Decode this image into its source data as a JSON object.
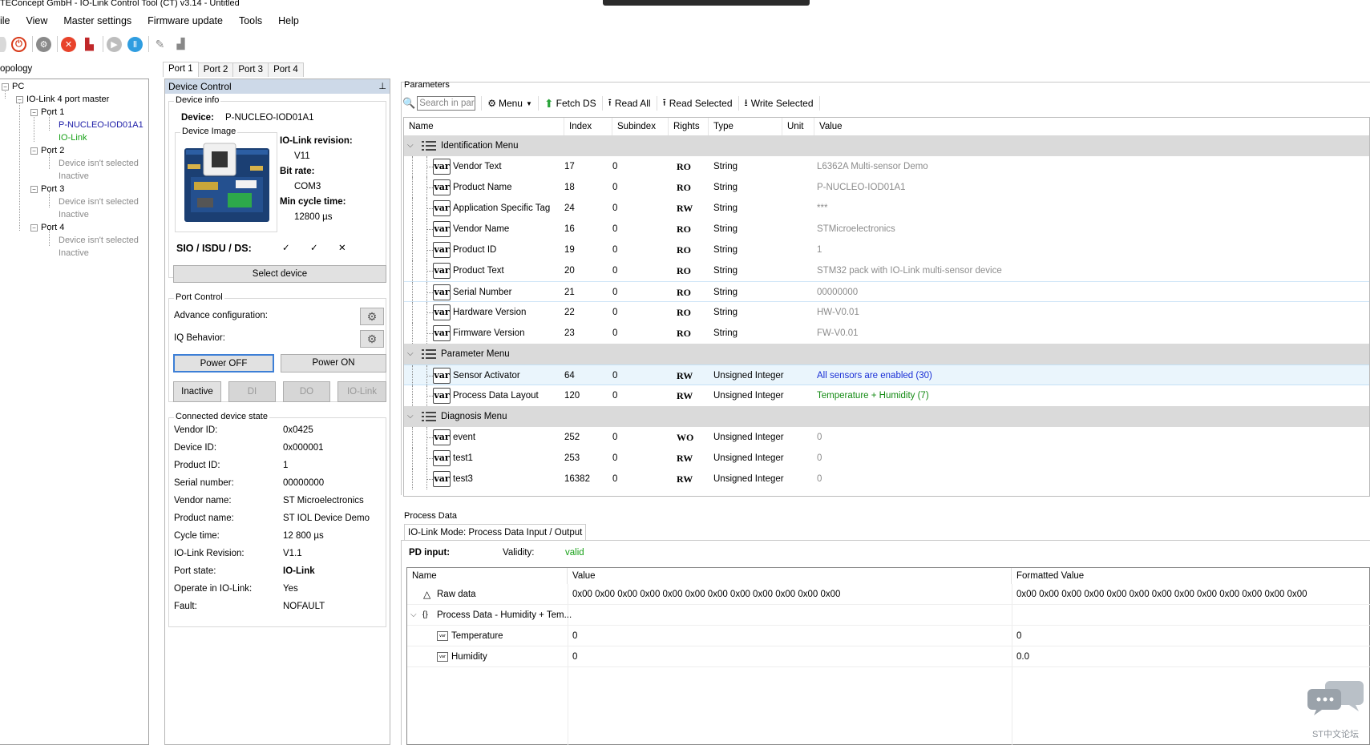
{
  "window": {
    "title": "TEConcept GmbH - IO-Link Control Tool (CT) v3.14 - Untitled"
  },
  "menu": [
    "ile",
    "View",
    "Master settings",
    "Firmware update",
    "Tools",
    "Help"
  ],
  "toolbar_icons": [
    "stop-icon",
    "power-icon",
    "gear-icon",
    "close-icon",
    "disconnect-icon",
    "play-icon",
    "pause-icon",
    "wrench-icon",
    "plug-icon"
  ],
  "topology": {
    "label": "opology",
    "root": "PC",
    "master": "IO-Link 4 port master",
    "ports": [
      {
        "name": "Port 1",
        "device": "P-NUCLEO-IOD01A1",
        "state": "IO-Link"
      },
      {
        "name": "Port 2",
        "device": "Device isn't selected",
        "state": "Inactive"
      },
      {
        "name": "Port 3",
        "device": "Device isn't selected",
        "state": "Inactive"
      },
      {
        "name": "Port 4",
        "device": "Device isn't selected",
        "state": "Inactive"
      }
    ]
  },
  "port_tabs": [
    "Port 1",
    "Port 2",
    "Port 3",
    "Port 4"
  ],
  "device_control": {
    "header": "Device Control",
    "pin": "⊥",
    "device_info_label": "Device info",
    "device_label": "Device:",
    "device_value": "P-NUCLEO-IOD01A1",
    "device_image_label": "Device Image",
    "iolink_revision_label": "IO-Link revision:",
    "iolink_revision_value": "V11",
    "bit_rate_label": "Bit rate:",
    "bit_rate_value": "COM3",
    "min_cycle_label": "Min cycle time:",
    "min_cycle_value": "12800 µs",
    "sio_label": "SIO / ISDU / DS:",
    "sio_values": [
      "✓",
      "✓",
      "✕"
    ],
    "select_device": "Select device",
    "port_control_label": "Port Control",
    "advance_config": "Advance configuration:",
    "iq_behavior": "IQ Behavior:",
    "power_off": "Power OFF",
    "power_on": "Power ON",
    "modes": [
      "Inactive",
      "DI",
      "DO",
      "IO-Link"
    ],
    "connected_state_label": "Connected device state",
    "state_rows": [
      {
        "label": "Vendor ID:",
        "value": "0x0425"
      },
      {
        "label": "Device ID:",
        "value": "0x000001"
      },
      {
        "label": "Product ID:",
        "value": "1"
      },
      {
        "label": "Serial number:",
        "value": "00000000"
      },
      {
        "label": "Vendor name:",
        "value": "ST Microelectronics"
      },
      {
        "label": "Product name:",
        "value": "ST IOL Device Demo"
      },
      {
        "label": "Cycle time:",
        "value": "12 800 µs"
      },
      {
        "label": "IO-Link Revision:",
        "value": "V1.1"
      },
      {
        "label": "Port state:",
        "value": "IO-Link"
      },
      {
        "label": "Operate in IO-Link:",
        "value": "Yes"
      },
      {
        "label": "Fault:",
        "value": "NOFAULT"
      }
    ]
  },
  "parameters": {
    "label": "Parameters",
    "search_placeholder": "Search in par...",
    "toolbar": {
      "menu": "Menu",
      "fetch": "Fetch DS",
      "read_all": "Read All",
      "read_selected": "Read Selected",
      "write_selected": "Write Selected"
    },
    "columns": [
      "Name",
      "Index",
      "Subindex",
      "Rights",
      "Type",
      "Unit",
      "Value"
    ],
    "var_label": "var",
    "groups": [
      {
        "name": "Identification Menu",
        "rows": [
          {
            "name": "Vendor Text",
            "index": "17",
            "sub": "0",
            "rights": "RO",
            "type": "String",
            "value": "L6362A Multi-sensor Demo"
          },
          {
            "name": "Product Name",
            "index": "18",
            "sub": "0",
            "rights": "RO",
            "type": "String",
            "value": "P-NUCLEO-IOD01A1"
          },
          {
            "name": "Application Specific Tag",
            "index": "24",
            "sub": "0",
            "rights": "RW",
            "type": "String",
            "value": "***"
          },
          {
            "name": "Vendor Name",
            "index": "16",
            "sub": "0",
            "rights": "RO",
            "type": "String",
            "value": "STMicroelectronics"
          },
          {
            "name": "Product ID",
            "index": "19",
            "sub": "0",
            "rights": "RO",
            "type": "String",
            "value": "1"
          },
          {
            "name": "Product Text",
            "index": "20",
            "sub": "0",
            "rights": "RO",
            "type": "String",
            "value": "STM32 pack with IO-Link multi-sensor device"
          },
          {
            "name": "Serial Number",
            "index": "21",
            "sub": "0",
            "rights": "RO",
            "type": "String",
            "value": "00000000"
          },
          {
            "name": "Hardware Version",
            "index": "22",
            "sub": "0",
            "rights": "RO",
            "type": "String",
            "value": "HW-V0.01"
          },
          {
            "name": "Firmware Version",
            "index": "23",
            "sub": "0",
            "rights": "RO",
            "type": "String",
            "value": "FW-V0.01"
          }
        ]
      },
      {
        "name": "Parameter Menu",
        "rows": [
          {
            "name": "Sensor Activator",
            "index": "64",
            "sub": "0",
            "rights": "RW",
            "type": "Unsigned Integer",
            "value": "All sensors are enabled (30)"
          },
          {
            "name": "Process Data Layout",
            "index": "120",
            "sub": "0",
            "rights": "RW",
            "type": "Unsigned Integer",
            "value": "Temperature + Humidity (7)"
          }
        ]
      },
      {
        "name": "Diagnosis Menu",
        "rows": [
          {
            "name": "event",
            "index": "252",
            "sub": "0",
            "rights": "WO",
            "type": "Unsigned Integer",
            "value": "0"
          },
          {
            "name": "test1",
            "index": "253",
            "sub": "0",
            "rights": "RW",
            "type": "Unsigned Integer",
            "value": "0"
          },
          {
            "name": "test3",
            "index": "16382",
            "sub": "0",
            "rights": "RW",
            "type": "Unsigned Integer",
            "value": "0"
          }
        ]
      }
    ]
  },
  "process_data": {
    "label": "Process Data",
    "tab": "IO-Link Mode: Process Data Input / Output",
    "pd_input_label": "PD input:",
    "validity_label": "Validity:",
    "validity_value": "valid",
    "columns": [
      "Name",
      "Value",
      "Formatted Value"
    ],
    "rows": [
      {
        "name": "Raw data",
        "value": "0x00 0x00 0x00 0x00 0x00 0x00 0x00 0x00 0x00 0x00 0x00 0x00",
        "formatted": "0x00 0x00 0x00 0x00 0x00 0x00 0x00 0x00 0x00 0x00 0x00 0x00 0x00"
      },
      {
        "name": "Process Data - Humidity + Tem...",
        "value": "",
        "formatted": ""
      },
      {
        "name": "Temperature",
        "value": "0",
        "formatted": "0"
      },
      {
        "name": "Humidity",
        "value": "0",
        "formatted": "0.0"
      }
    ],
    "var_label": "var"
  },
  "watermark": "ST中文论坛",
  "colors": {
    "header_blue": "#cdd9e8",
    "group_gray": "#dadada",
    "valid_green": "#17a017",
    "value_blue": "#1a2fd6"
  }
}
